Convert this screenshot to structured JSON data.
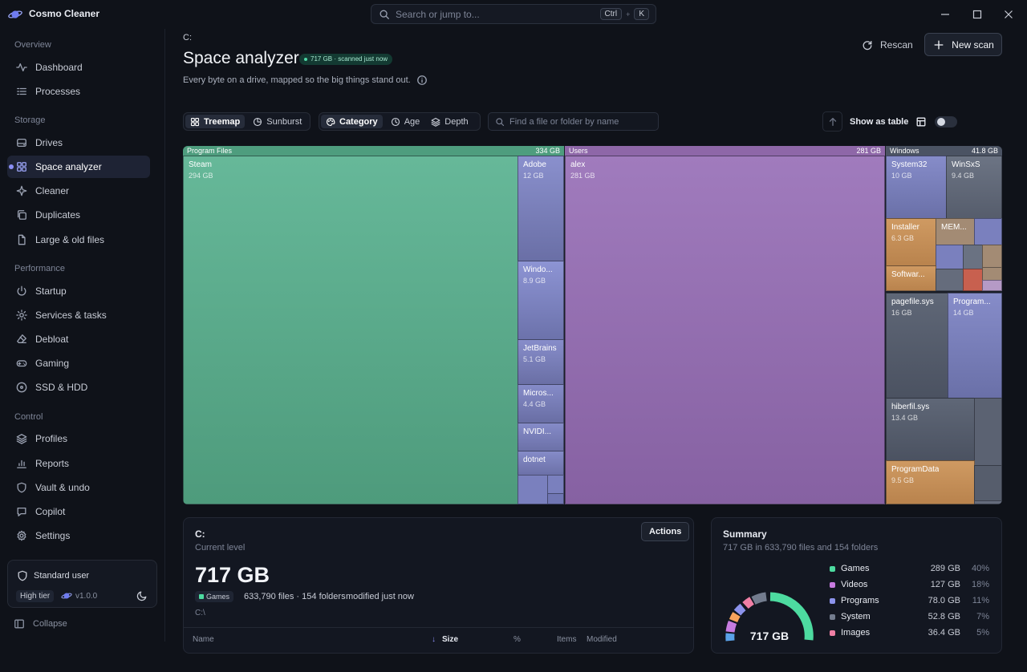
{
  "app": {
    "title": "Cosmo Cleaner"
  },
  "search": {
    "placeholder": "Search or jump to...",
    "key1": "Ctrl",
    "plus": "+",
    "key2": "K"
  },
  "sidebar": {
    "sections": {
      "overview": "Overview",
      "storage": "Storage",
      "performance": "Performance",
      "control": "Control"
    },
    "items": [
      {
        "label": "Dashboard",
        "icon": "pulse-icon"
      },
      {
        "label": "Processes",
        "icon": "list-icon"
      },
      {
        "label": "Drives",
        "icon": "drive-icon"
      },
      {
        "label": "Space analyzer",
        "icon": "grid-icon",
        "active": true
      },
      {
        "label": "Cleaner",
        "icon": "sparkle-icon"
      },
      {
        "label": "Duplicates",
        "icon": "copy-icon"
      },
      {
        "label": "Large & old files",
        "icon": "file-icon"
      },
      {
        "label": "Startup",
        "icon": "power-icon"
      },
      {
        "label": "Services & tasks",
        "icon": "gear-icon"
      },
      {
        "label": "Debloat",
        "icon": "eraser-icon"
      },
      {
        "label": "Gaming",
        "icon": "gamepad-icon"
      },
      {
        "label": "SSD & HDD",
        "icon": "disk-icon"
      },
      {
        "label": "Profiles",
        "icon": "layers-icon"
      },
      {
        "label": "Reports",
        "icon": "bar-chart-icon"
      },
      {
        "label": "Vault & undo",
        "icon": "shield-icon"
      },
      {
        "label": "Copilot",
        "icon": "chat-icon"
      },
      {
        "label": "Settings",
        "icon": "settings-icon"
      }
    ],
    "user": {
      "role": "Standard user",
      "tier": "High tier",
      "version": "v1.0.0"
    },
    "collapse": "Collapse"
  },
  "header": {
    "breadcrumb": "C:",
    "title": "Space analyzer",
    "badge": "717 GB · scanned just now",
    "subtitle": "Every byte on a drive, mapped so the big things stand out.",
    "rescan": "Rescan",
    "new_scan": "New scan"
  },
  "toolbar": {
    "view_treemap": "Treemap",
    "view_sunburst": "Sunburst",
    "color_category": "Category",
    "color_age": "Age",
    "color_depth": "Depth",
    "find_placeholder": "Find a file or folder by name",
    "show_as_table": "Show as table",
    "show_as_table_on": false
  },
  "treemap": {
    "groups": [
      {
        "name": "Program Files",
        "size": "334 GB"
      },
      {
        "name": "Users",
        "size": "281 GB"
      },
      {
        "name": "Windows",
        "size": "41.8 GB"
      }
    ],
    "cells": [
      {
        "name": "Steam",
        "size": "294 GB"
      },
      {
        "name": "Adobe",
        "size": "12 GB"
      },
      {
        "name": "Windo...",
        "size": "8.9 GB"
      },
      {
        "name": "JetBrains",
        "size": "5.1 GB"
      },
      {
        "name": "Micros...",
        "size": "4.4 GB"
      },
      {
        "name": "NVIDI...",
        "size": ""
      },
      {
        "name": "dotnet",
        "size": ""
      },
      {
        "name": "alex",
        "size": "281 GB"
      },
      {
        "name": "System32",
        "size": "10 GB"
      },
      {
        "name": "WinSxS",
        "size": "9.4 GB"
      },
      {
        "name": "Installer",
        "size": "6.3 GB"
      },
      {
        "name": "MEM...",
        "size": ""
      },
      {
        "name": "Softwar...",
        "size": ""
      },
      {
        "name": "pagefile.sys",
        "size": "16 GB"
      },
      {
        "name": "Program...",
        "size": "14 GB"
      },
      {
        "name": "hiberfil.sys",
        "size": "13.4 GB"
      },
      {
        "name": "ProgramData",
        "size": "9.5 GB"
      }
    ]
  },
  "detail": {
    "title": "C:",
    "level": "Current level",
    "actions": "Actions",
    "size": "717 GB",
    "tag": "Games",
    "meta": "633,790 files · 154 folders",
    "modified": "modified just now",
    "path": "C:\\",
    "columns": {
      "name": "Name",
      "size": "Size",
      "percent": "%",
      "items": "Items",
      "modified": "Modified"
    }
  },
  "summary": {
    "title": "Summary",
    "subtitle": "717 GB in 633,790 files and 154 folders",
    "total": "717 GB",
    "legend": [
      {
        "name": "Games",
        "value": "289 GB",
        "pct": "40%",
        "color": "#4ddba0"
      },
      {
        "name": "Videos",
        "value": "127 GB",
        "pct": "18%",
        "color": "#c77be0"
      },
      {
        "name": "Programs",
        "value": "78.0 GB",
        "pct": "11%",
        "color": "#8c93ec"
      },
      {
        "name": "System",
        "value": "52.8 GB",
        "pct": "7%",
        "color": "#737c8e"
      },
      {
        "name": "Images",
        "value": "36.4 GB",
        "pct": "5%",
        "color": "#f07fa5"
      }
    ]
  }
}
